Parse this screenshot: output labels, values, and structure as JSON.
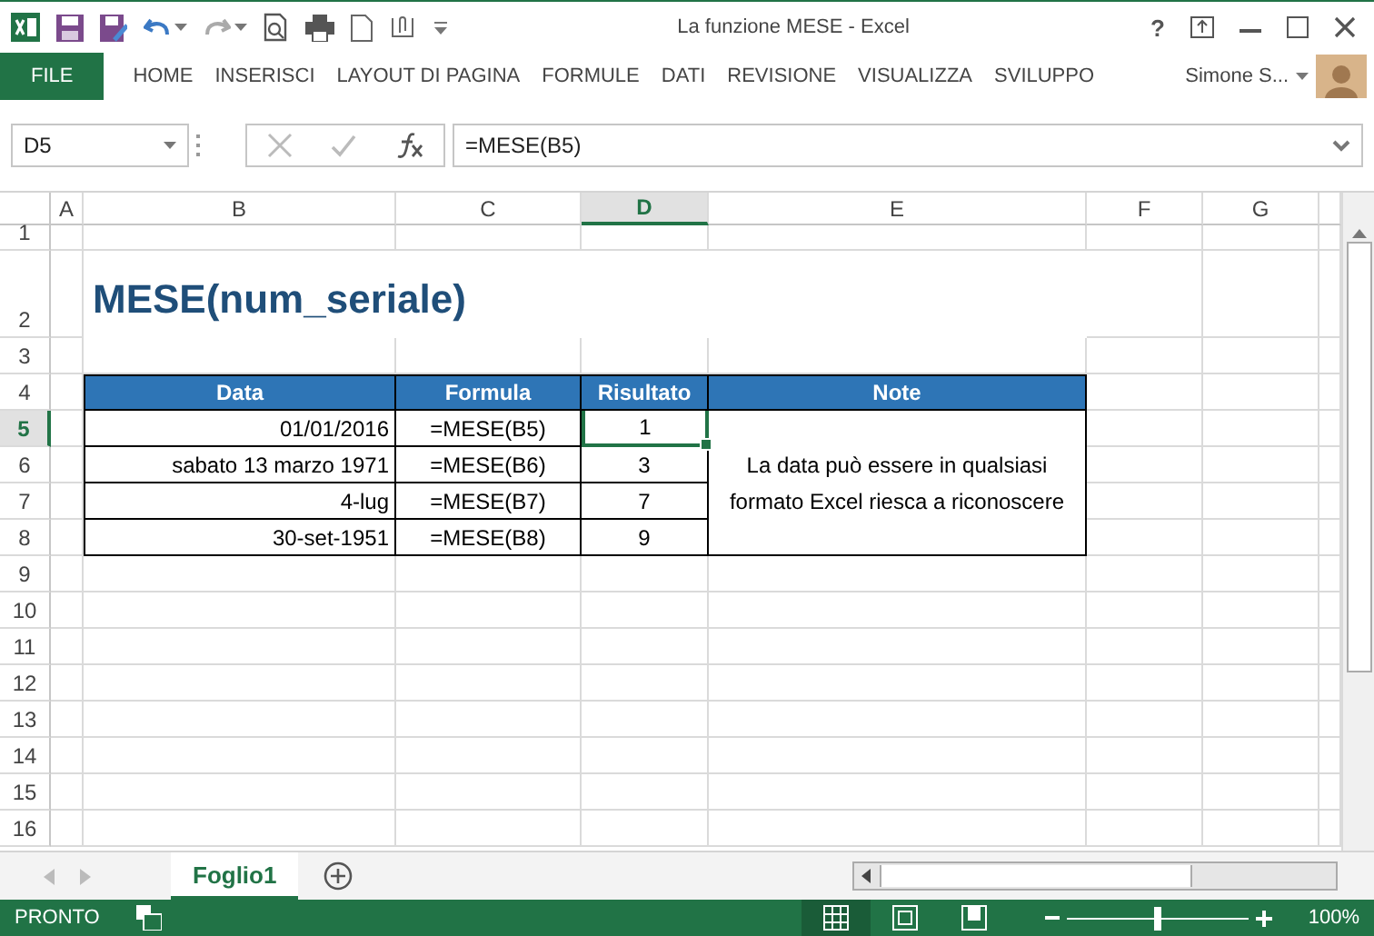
{
  "window": {
    "title": "La funzione MESE - Excel",
    "help": "?"
  },
  "file_tab": "FILE",
  "ribbon_tabs": [
    {
      "label": "HOME",
      "selected": false
    },
    {
      "label": "INSERISCI",
      "selected": false
    },
    {
      "label": "LAYOUT DI PAGINA",
      "selected": false
    },
    {
      "label": "FORMULE",
      "selected": false
    },
    {
      "label": "DATI",
      "selected": false
    },
    {
      "label": "REVISIONE",
      "selected": false
    },
    {
      "label": "VISUALIZZA",
      "selected": false
    },
    {
      "label": "SVILUPPO",
      "selected": false
    }
  ],
  "user": {
    "name": "Simone S..."
  },
  "formula_bar": {
    "name_box": "D5",
    "formula": "=MESE(B5)"
  },
  "sheet": {
    "columns": [
      {
        "label": "A",
        "selected": false
      },
      {
        "label": "B",
        "selected": false
      },
      {
        "label": "C",
        "selected": false
      },
      {
        "label": "D",
        "selected": true
      },
      {
        "label": "E",
        "selected": false
      },
      {
        "label": "F",
        "selected": false
      },
      {
        "label": "G",
        "selected": false
      }
    ],
    "rows": [
      {
        "label": "1",
        "selected": false
      },
      {
        "label": "2",
        "selected": false
      },
      {
        "label": "3",
        "selected": false
      },
      {
        "label": "4",
        "selected": false
      },
      {
        "label": "5",
        "selected": true
      },
      {
        "label": "6",
        "selected": false
      },
      {
        "label": "7",
        "selected": false
      },
      {
        "label": "8",
        "selected": false
      },
      {
        "label": "9",
        "selected": false
      },
      {
        "label": "10",
        "selected": false
      },
      {
        "label": "11",
        "selected": false
      },
      {
        "label": "12",
        "selected": false
      },
      {
        "label": "13",
        "selected": false
      },
      {
        "label": "14",
        "selected": false
      },
      {
        "label": "15",
        "selected": false
      },
      {
        "label": "16",
        "selected": false
      }
    ],
    "title": "MESE(num_seriale)",
    "table": {
      "headers": [
        "Data",
        "Formula",
        "Risultato",
        "Note"
      ],
      "rows": [
        {
          "data": "01/01/2016",
          "formula": "=MESE(B5)",
          "result": "1",
          "selected": true
        },
        {
          "data": "sabato 13 marzo 1971",
          "formula": "=MESE(B6)",
          "result": "3",
          "selected": false
        },
        {
          "data": "4-lug",
          "formula": "=MESE(B7)",
          "result": "7",
          "selected": false
        },
        {
          "data": "30-set-1951",
          "formula": "=MESE(B8)",
          "result": "9",
          "selected": false
        }
      ],
      "note": "La data può essere in qualsiasi formato Excel riesca a riconoscere"
    }
  },
  "sheet_tabs": [
    {
      "label": "Foglio1",
      "selected": true
    }
  ],
  "status_bar": {
    "text": "PRONTO",
    "views": [
      {
        "kind": "normal",
        "selected": true
      },
      {
        "kind": "page_layout",
        "selected": false
      },
      {
        "kind": "page_break",
        "selected": false
      }
    ],
    "zoom": {
      "level": 0.5,
      "reading": "100%"
    }
  }
}
